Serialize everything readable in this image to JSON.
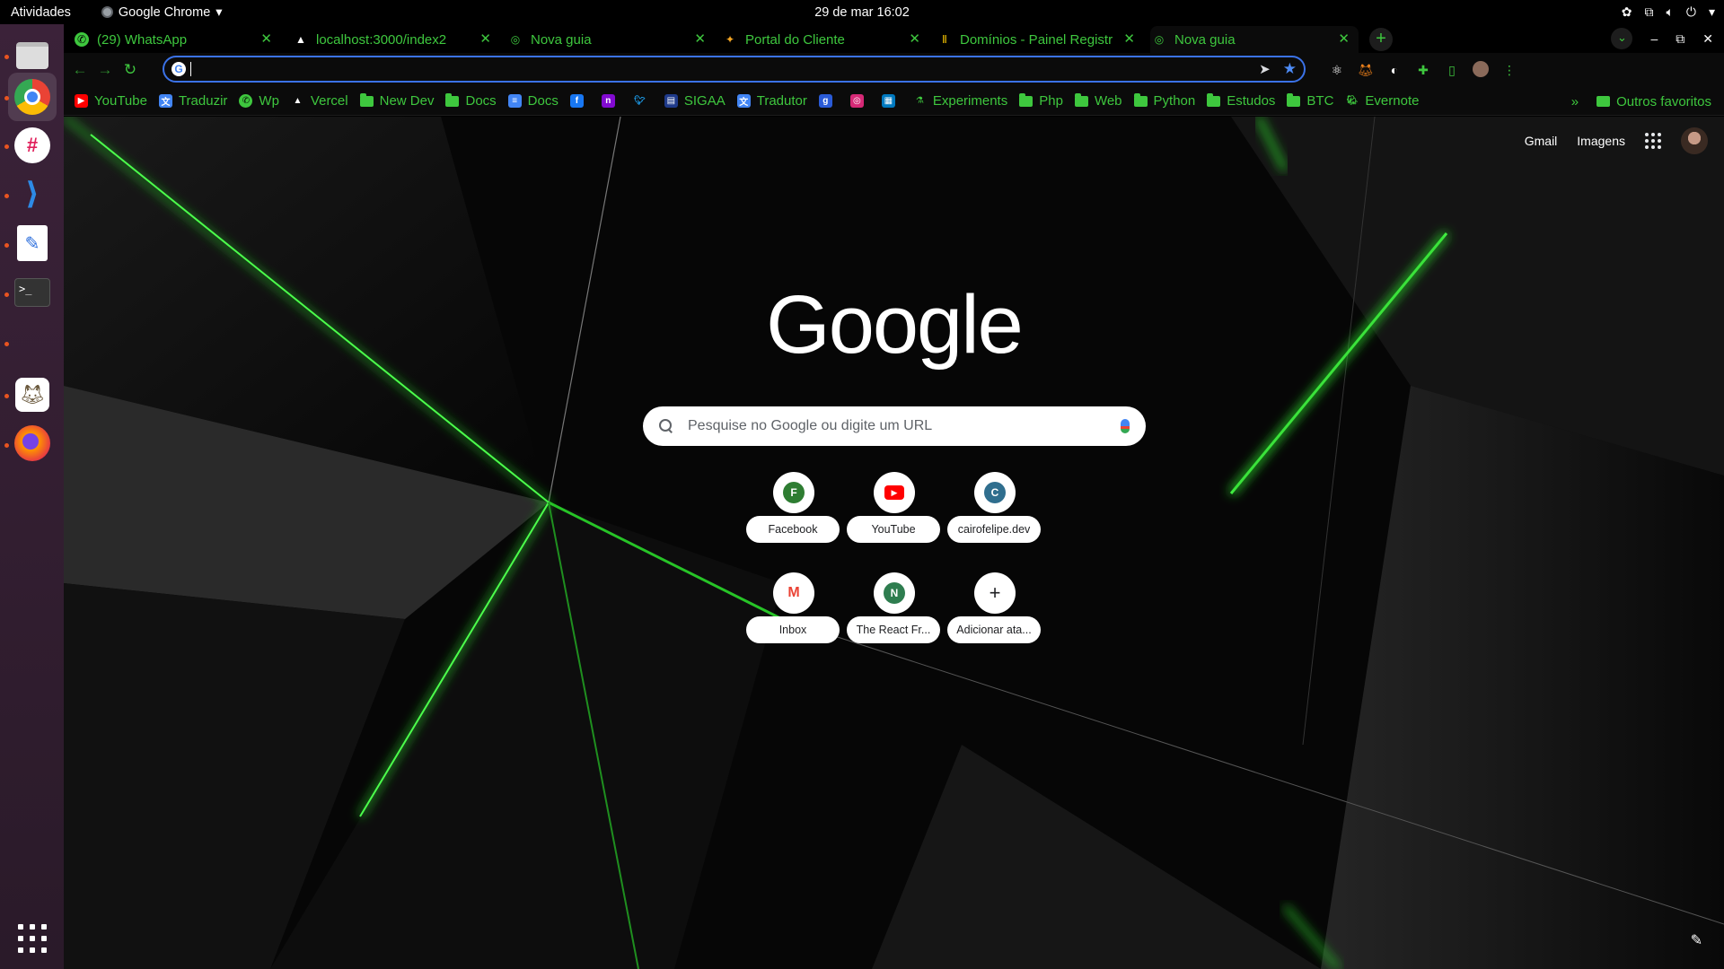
{
  "topbar": {
    "activities": "Atividades",
    "app_name": "Google Chrome",
    "clock": "29 de mar  16:02"
  },
  "tabs": [
    {
      "title": "(29) WhatsApp",
      "icon": "whatsapp-icon"
    },
    {
      "title": "localhost:3000/index2",
      "icon": "vercel-triangle-icon"
    },
    {
      "title": "Nova guia",
      "icon": "chrome-icon"
    },
    {
      "title": "Portal do Cliente",
      "icon": "portal-icon"
    },
    {
      "title": "Domínios - Painel Registr",
      "icon": "registro-icon"
    },
    {
      "title": "Nova guia",
      "icon": "chrome-icon",
      "active": true
    }
  ],
  "omnibox": {
    "value": "",
    "placeholder": ""
  },
  "bookmarks": [
    {
      "label": "YouTube",
      "type": "site",
      "icon": "youtube-icon"
    },
    {
      "label": "Traduzir",
      "type": "site",
      "icon": "translate-icon"
    },
    {
      "label": "Wp",
      "type": "site",
      "icon": "whatsapp-icon"
    },
    {
      "label": "Vercel",
      "type": "site",
      "icon": "vercel-triangle-icon"
    },
    {
      "label": "New Dev",
      "type": "folder"
    },
    {
      "label": "Docs",
      "type": "folder"
    },
    {
      "label": "Docs",
      "type": "site",
      "icon": "google-docs-icon"
    },
    {
      "label": "",
      "type": "site",
      "icon": "facebook-icon"
    },
    {
      "label": "",
      "type": "site",
      "icon": "nubank-icon"
    },
    {
      "label": "",
      "type": "site",
      "icon": "twitter-icon"
    },
    {
      "label": "SIGAA",
      "type": "site",
      "icon": "sigaa-icon"
    },
    {
      "label": "Tradutor",
      "type": "site",
      "icon": "translate-icon"
    },
    {
      "label": "",
      "type": "site",
      "icon": "g-icon"
    },
    {
      "label": "",
      "type": "site",
      "icon": "instagram-icon"
    },
    {
      "label": "",
      "type": "site",
      "icon": "trello-icon"
    },
    {
      "label": "Experiments",
      "type": "site",
      "icon": "experiments-icon"
    },
    {
      "label": "Php",
      "type": "folder"
    },
    {
      "label": "Web",
      "type": "folder"
    },
    {
      "label": "Python",
      "type": "folder"
    },
    {
      "label": "Estudos",
      "type": "folder"
    },
    {
      "label": "BTC",
      "type": "folder"
    },
    {
      "label": "Evernote",
      "type": "site",
      "icon": "evernote-icon"
    }
  ],
  "bookmarks_more": "»",
  "other_bookmarks": "Outros favoritos",
  "ntp": {
    "gmail": "Gmail",
    "images": "Imagens",
    "logo": "Google",
    "search_placeholder": "Pesquise no Google ou digite um URL",
    "shortcuts": [
      {
        "label": "Facebook",
        "letter": "F",
        "color": "#2e7d32"
      },
      {
        "label": "YouTube",
        "letter": "",
        "color": "#ff0000"
      },
      {
        "label": "cairofelipe.dev",
        "letter": "C",
        "color": "#2f6e8e"
      },
      {
        "label": "Inbox",
        "letter": "M",
        "color": "#ea4335"
      },
      {
        "label": "The React Fr...",
        "letter": "N",
        "color": "#2e7d4f"
      },
      {
        "label": "Adicionar ata...",
        "letter": "+",
        "color": "#ffffff"
      }
    ]
  },
  "colors": {
    "accent_green": "#3ec73e",
    "omnibox_focus": "#3b72e8",
    "ubuntu_orange": "#e95420"
  }
}
